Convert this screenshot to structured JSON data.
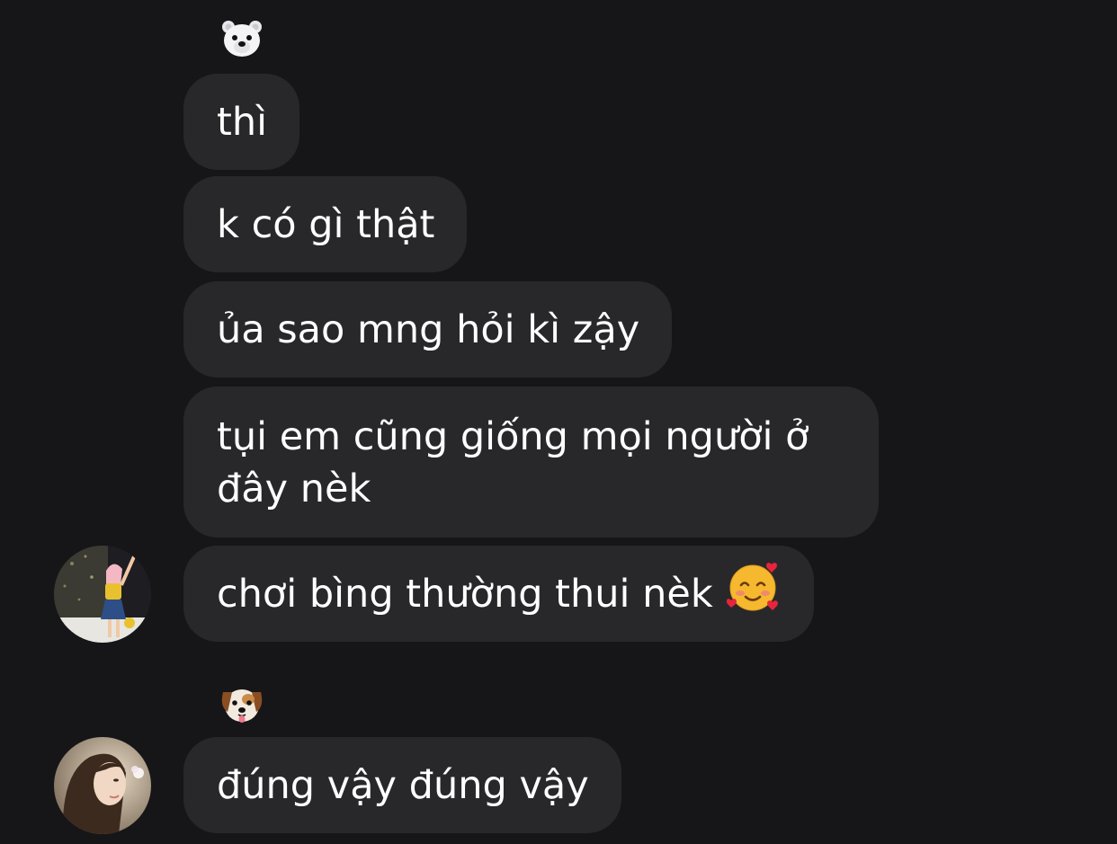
{
  "conversation": {
    "group1": {
      "sender_icon": "polar-bear-face-emoji",
      "messages": [
        {
          "text": "thì"
        },
        {
          "text": "k có gì thật"
        },
        {
          "text": "ủa sao mng hỏi kì zậy"
        },
        {
          "line1": "tụi em cũng giống mọi người ở",
          "line2": "đây nèk"
        },
        {
          "text": "chơi bìng thường thui nèk",
          "emoji": "smiling-face-with-hearts-emoji"
        }
      ],
      "avatar": "user-avatar-photo-1"
    },
    "group2": {
      "sender_icon": "dog-face-emoji",
      "messages": [
        {
          "text": "đúng vậy đúng vậy"
        }
      ],
      "avatar": "user-avatar-photo-2"
    }
  },
  "colors": {
    "background": "#161618",
    "bubble": "#28282b",
    "text": "#ffffff"
  }
}
